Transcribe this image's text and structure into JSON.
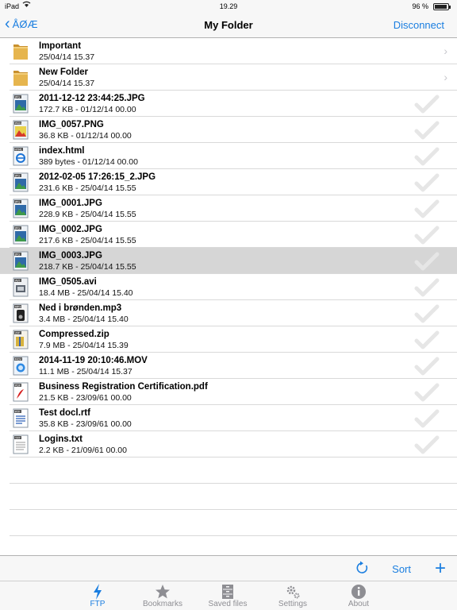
{
  "status_bar": {
    "device": "iPad",
    "time": "19.29",
    "battery_pct": "96 %",
    "battery_level": 0.96
  },
  "navbar": {
    "back_label": "ÅØÆ",
    "title": "My Folder",
    "right_label": "Disconnect"
  },
  "files": [
    {
      "name": "Important",
      "meta": "25/04/14 15.37",
      "type": "folder"
    },
    {
      "name": "New Folder",
      "meta": "25/04/14 15.37",
      "type": "folder"
    },
    {
      "name": "2011-12-12 23:44:25.JPG",
      "meta": "172.7 KB - 01/12/14 00.00",
      "type": "jpg"
    },
    {
      "name": "IMG_0057.PNG",
      "meta": "36.8 KB - 01/12/14 00.00",
      "type": "png"
    },
    {
      "name": "index.html",
      "meta": "389 bytes - 01/12/14 00.00",
      "type": "html"
    },
    {
      "name": "2012-02-05 17:26:15_2.JPG",
      "meta": "231.6 KB - 25/04/14 15.55",
      "type": "jpg"
    },
    {
      "name": "IMG_0001.JPG",
      "meta": "228.9 KB - 25/04/14 15.55",
      "type": "jpg"
    },
    {
      "name": "IMG_0002.JPG",
      "meta": "217.6 KB - 25/04/14 15.55",
      "type": "jpg"
    },
    {
      "name": "IMG_0003.JPG",
      "meta": "218.7 KB - 25/04/14 15.55",
      "type": "jpg",
      "selected": true
    },
    {
      "name": "IMG_0505.avi",
      "meta": "18.4 MB - 25/04/14 15.40",
      "type": "avi"
    },
    {
      "name": "Ned i brønden.mp3",
      "meta": "3.4 MB - 25/04/14 15.40",
      "type": "mp3"
    },
    {
      "name": "Compressed.zip",
      "meta": "7.9 MB - 25/04/14 15.39",
      "type": "zip"
    },
    {
      "name": "2014-11-19 20:10:46.MOV",
      "meta": "11.1 MB - 25/04/14 15.37",
      "type": "mov"
    },
    {
      "name": "Business Registration Certification.pdf",
      "meta": "21.5 KB - 23/09/61 00.00",
      "type": "pdf"
    },
    {
      "name": "Test docl.rtf",
      "meta": "35.8 KB - 23/09/61 00.00",
      "type": "rtf"
    },
    {
      "name": "Logins.txt",
      "meta": "2.2 KB - 21/09/61 00.00",
      "type": "txt"
    }
  ],
  "toolbar": {
    "sort_label": "Sort",
    "add_label": "+"
  },
  "tabs": [
    {
      "label": "FTP",
      "icon": "bolt-icon",
      "active": true
    },
    {
      "label": "Bookmarks",
      "icon": "star-icon",
      "active": false
    },
    {
      "label": "Saved files",
      "icon": "cabinet-icon",
      "active": false
    },
    {
      "label": "Settings",
      "icon": "gear-icon",
      "active": false
    },
    {
      "label": "About",
      "icon": "info-icon",
      "active": false
    }
  ],
  "colors": {
    "accent": "#1a7ee0",
    "selected_row": "#d6d6d6",
    "folder": "#e3b24a"
  }
}
